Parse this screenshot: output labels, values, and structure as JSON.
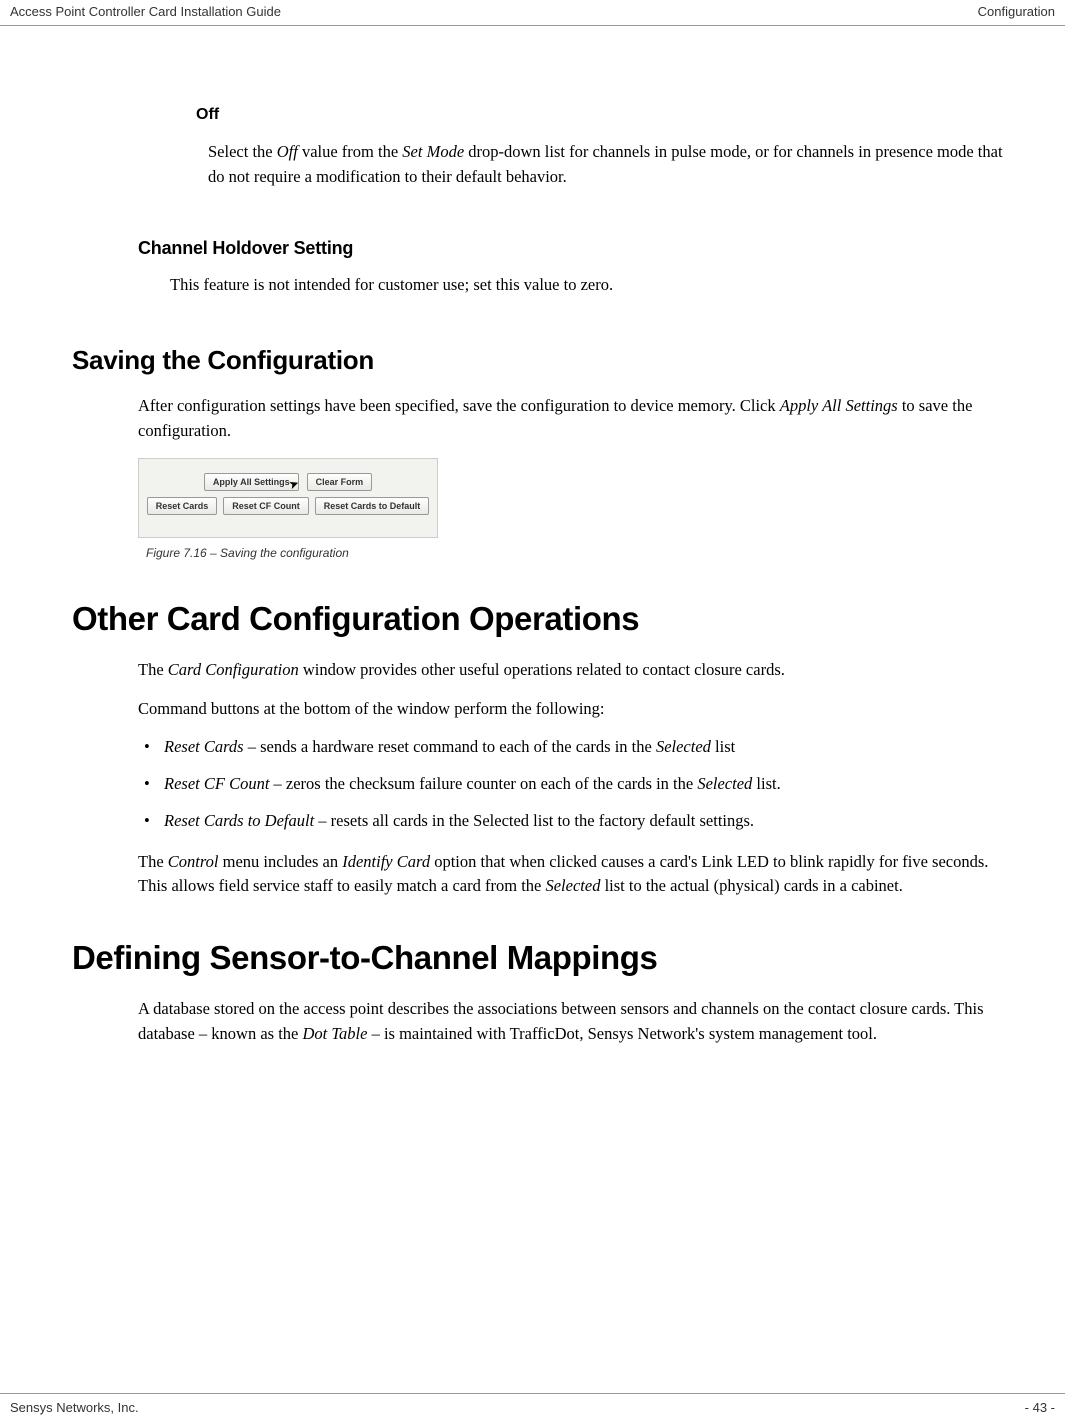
{
  "header": {
    "left": "Access Point Controller Card Installation Guide",
    "right": "Configuration"
  },
  "off": {
    "title": "Off",
    "body_pre": "Select the ",
    "body_em1": "Off",
    "body_mid1": " value from the ",
    "body_em2": "Set Mode",
    "body_post": " drop-down list for channels in pulse mode, or for channels in presence mode that do not require a modification to their default behavior."
  },
  "ch_holdover": {
    "title": "Channel Holdover Setting",
    "body": "This feature is not intended for customer use; set this value to zero."
  },
  "saving": {
    "title": "Saving the Configuration",
    "body_pre": "After configuration settings have been specified, save the configuration to device memory. Click ",
    "body_em": "Apply All Settings",
    "body_post": " to save the configuration."
  },
  "figure": {
    "btn_apply": "Apply All Settings",
    "btn_clear": "Clear Form",
    "btn_reset_cards": "Reset Cards",
    "btn_reset_cf": "Reset CF Count",
    "btn_reset_default": "Reset Cards to Default",
    "caption": "Figure 7.16 – Saving the configuration"
  },
  "other_ops": {
    "title": "Other Card Configuration Operations",
    "p1_pre": "The ",
    "p1_em": "Card Configuration",
    "p1_post": " window provides other useful operations related to contact closure cards.",
    "p2": "Command buttons at the bottom of the window perform the following:",
    "li1_em": "Reset Cards",
    "li1_mid": " – sends a hardware reset command to each of the cards in the ",
    "li1_em2": "Selected",
    "li1_post": " list",
    "li2_em": "Reset CF Count",
    "li2_mid": " – zeros the checksum failure counter on each of the cards in the ",
    "li2_em2": "Selected",
    "li2_post": " list.",
    "li3_em": "Reset Cards to Default",
    "li3_post": " – resets all cards in the Selected list to the factory default settings.",
    "p3_pre": "The ",
    "p3_em1": "Control",
    "p3_mid1": " menu includes an ",
    "p3_em2": "Identify Card",
    "p3_mid2": " option that when clicked causes a card's Link LED to blink rapidly for five seconds. This allows field service staff to easily match a card from the ",
    "p3_em3": "Selected",
    "p3_post": " list to the actual (physical) cards in a cabinet."
  },
  "defining": {
    "title": "Defining Sensor-to-Channel Mappings",
    "body_pre": "A database stored on the access point describes the associations between sensors and channels on the contact closure cards. This database – known as the ",
    "body_em": "Dot Table",
    "body_post": " – is maintained with TrafficDot, Sensys Network's system management tool."
  },
  "footer": {
    "left": "Sensys Networks, Inc.",
    "right": "- 43 -"
  }
}
